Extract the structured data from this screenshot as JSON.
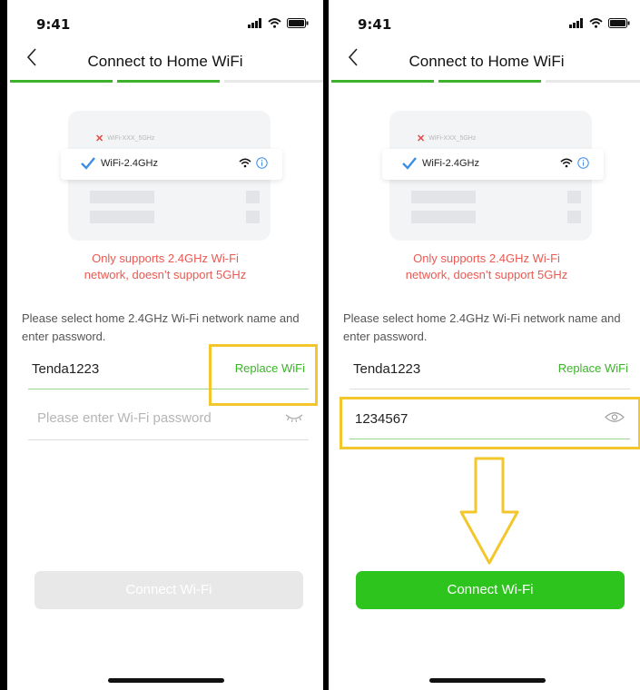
{
  "status": {
    "time": "9:41"
  },
  "nav": {
    "title": "Connect to Home WiFi"
  },
  "illustration": {
    "bad_network": "WiFi-XXX_5GHz",
    "good_network": "WiFi-2.4GHz"
  },
  "warning": {
    "line1": "Only supports 2.4GHz Wi-Fi",
    "line2": "network, doesn’t support 5GHz"
  },
  "instruction": "Please select home 2.4GHz Wi-Fi network name and enter password.",
  "left": {
    "wifi_name": "Tenda1223",
    "replace_label": "Replace WiFi",
    "password_placeholder": "Please enter Wi-Fi password",
    "connect_label": "Connect Wi-Fi"
  },
  "right": {
    "wifi_name": "Tenda1223",
    "replace_label": "Replace WiFi",
    "password_value": "1234567",
    "connect_label": "Connect Wi-Fi"
  },
  "colors": {
    "accent_green": "#3cb32a",
    "button_active": "#2ec41e",
    "button_disabled": "#e8e8e8",
    "warning_red": "#e85a52",
    "highlight_yellow": "#f3c72b"
  },
  "icons": [
    "signal-icon",
    "wifi-icon",
    "battery-icon",
    "back-icon",
    "close-x-icon",
    "checkmark-icon",
    "info-icon",
    "eye-closed-icon",
    "eye-open-icon",
    "down-arrow-icon"
  ]
}
